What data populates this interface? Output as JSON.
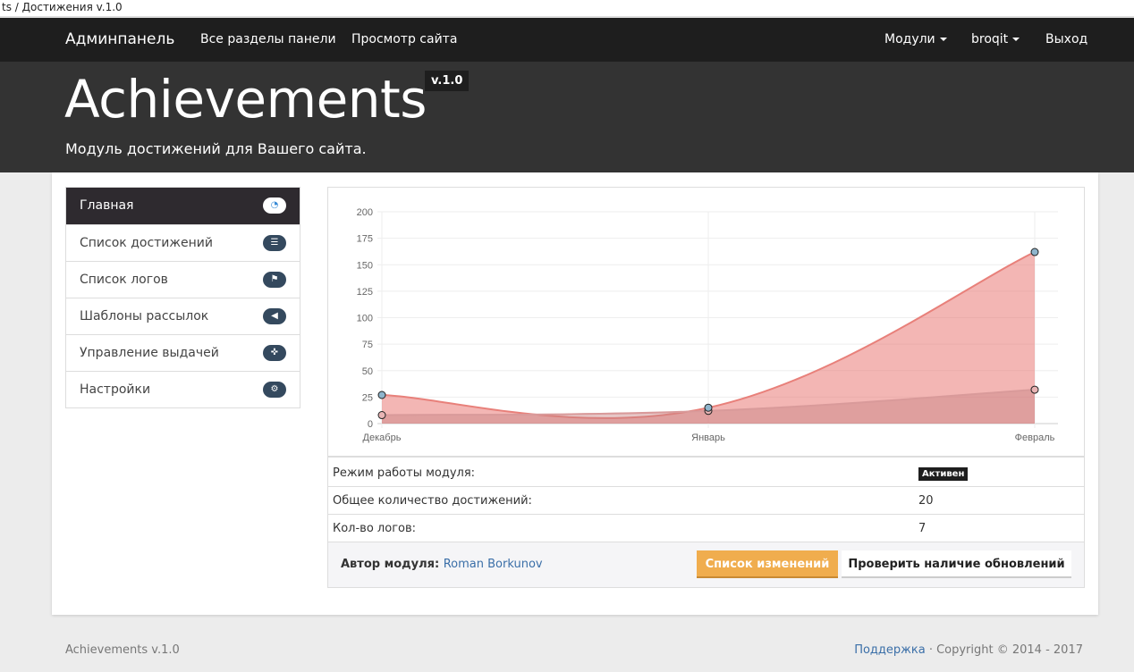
{
  "browser_tab": "ts / Достижения v.1.0",
  "navbar": {
    "brand": "Админпанель",
    "links": [
      "Все разделы панели",
      "Просмотр сайта"
    ],
    "right": [
      "Модули",
      "broqit",
      "Выход"
    ]
  },
  "header": {
    "title": "Achievements",
    "version": "v.1.0",
    "subtitle": "Модуль достижений для Вашего сайта."
  },
  "sidebar": {
    "items": [
      {
        "label": "Главная",
        "icon": "dashboard-icon"
      },
      {
        "label": "Список достижений",
        "icon": "list-icon"
      },
      {
        "label": "Список логов",
        "icon": "flag-icon"
      },
      {
        "label": "Шаблоны рассылок",
        "icon": "bullhorn-icon"
      },
      {
        "label": "Управление выдачей",
        "icon": "crosshairs-icon"
      },
      {
        "label": "Настройки",
        "icon": "gear-icon"
      }
    ]
  },
  "chart_data": {
    "type": "area",
    "categories": [
      "Декабрь",
      "Январь",
      "Февраль"
    ],
    "ylim": [
      0,
      200
    ],
    "yticks": [
      0,
      25,
      50,
      75,
      100,
      125,
      150,
      175,
      200
    ],
    "series": [
      {
        "name": "series-1",
        "values": [
          27,
          15,
          162
        ],
        "color": "#e8807a"
      },
      {
        "name": "series-2",
        "values": [
          8,
          12,
          32
        ],
        "color": "#d99a9a"
      }
    ],
    "grid": true
  },
  "stats": [
    {
      "label": "Режим работы модуля:",
      "value": "Активен"
    },
    {
      "label": "Общее количество достижений:",
      "value": "20"
    },
    {
      "label": "Кол-во логов:",
      "value": "7"
    }
  ],
  "footer_panel": {
    "author_label": "Автор модуля:",
    "author_name": "Roman Borkunov",
    "changelog_button": "Список изменений",
    "check_updates_button": "Проверить наличие обновлений"
  },
  "page_footer": {
    "left": "Achievements v.1.0",
    "support": "Поддержка",
    "copyright": " · Copyright © 2014 - 2017"
  }
}
